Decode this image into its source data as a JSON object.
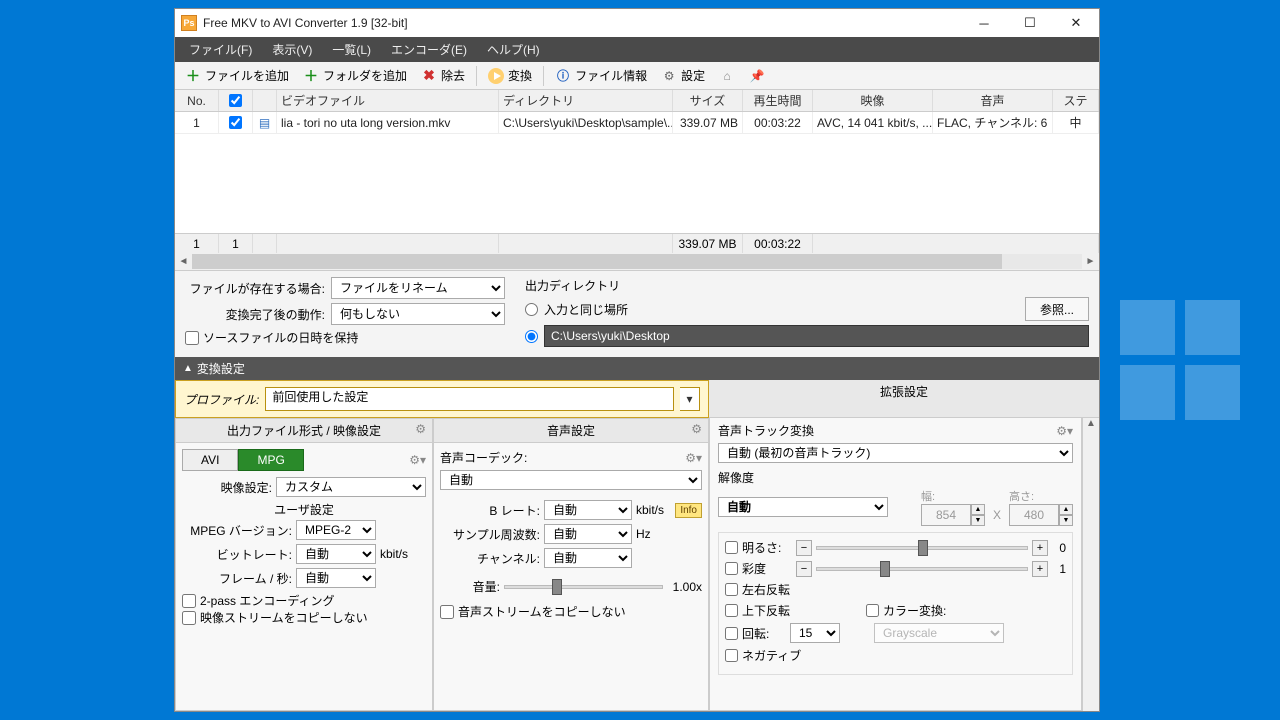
{
  "window": {
    "title": "Free MKV to AVI Converter 1.9  [32-bit]"
  },
  "menu": {
    "file": "ファイル(F)",
    "view": "表示(V)",
    "list": "一覧(L)",
    "encoder": "エンコーダ(E)",
    "help": "ヘルプ(H)"
  },
  "toolbar": {
    "add_file": "ファイルを追加",
    "add_folder": "フォルダを追加",
    "remove": "除去",
    "convert": "変換",
    "file_info": "ファイル情報",
    "settings": "設定"
  },
  "grid": {
    "headers": {
      "no": "No.",
      "video_file": "ビデオファイル",
      "directory": "ディレクトリ",
      "size": "サイズ",
      "duration": "再生時間",
      "video": "映像",
      "audio": "音声",
      "status": "ステ"
    },
    "row": {
      "no": "1",
      "file": "lia - tori no uta long version.mkv",
      "dir": "C:\\Users\\yuki\\Desktop\\sample\\...",
      "size": "339.07 MB",
      "duration": "00:03:22",
      "video": "AVC, 14 041 kbit/s, ...",
      "audio": "FLAC, チャンネル: 6",
      "status": "中"
    },
    "footer": {
      "count1": "1",
      "count2": "1",
      "size": "339.07 MB",
      "duration": "00:03:22"
    }
  },
  "opts": {
    "exists_label": "ファイルが存在する場合:",
    "exists_value": "ファイルをリネーム",
    "after_label": "変換完了後の動作:",
    "after_value": "何もしない",
    "preserve_date": "ソースファイルの日時を保持",
    "outdir_label": "出力ディレクトリ",
    "same_as_input": "入力と同じ場所",
    "custom_path": "C:\\Users\\yuki\\Desktop",
    "browse": "参照..."
  },
  "conv": {
    "section": "変換設定",
    "profile_label": "プロファイル:",
    "profile_value": "前回使用した設定",
    "video_panel": "出力ファイル形式 / 映像設定",
    "audio_panel": "音声設定",
    "ext_panel": "拡張設定",
    "tab_avi": "AVI",
    "tab_mpg": "MPG",
    "vset_label": "映像設定:",
    "vset_value": "カスタム",
    "user_set": "ユーザ設定",
    "mpeg_ver_label": "MPEG バージョン:",
    "mpeg_ver_value": "MPEG-2",
    "bitrate_label": "ビットレート:",
    "bitrate_value": "自動",
    "bitrate_unit": "kbit/s",
    "fps_label": "フレーム / 秒:",
    "fps_value": "自動",
    "twopass": "2-pass エンコーディング",
    "copy_vstream": "映像ストリームをコピーしない",
    "acodec_label": "音声コーデック:",
    "acodec_value": "自動",
    "abitrate_label": "B レート:",
    "abitrate_value": "自動",
    "abitrate_unit": "kbit/s",
    "asample_label": "サンプル周波数:",
    "asample_value": "自動",
    "asample_unit": "Hz",
    "achannel_label": "チャンネル:",
    "achannel_value": "自動",
    "avolume_label": "音量:",
    "avolume_value": "1.00x",
    "copy_astream": "音声ストリームをコピーしない",
    "info_badge": "Info",
    "atrack_label": "音声トラック変換",
    "atrack_value": "自動 (最初の音声トラック)",
    "res_label": "解像度",
    "res_value": "自動",
    "width_label": "幅:",
    "width_value": "854",
    "height_label": "高さ:",
    "height_value": "480",
    "x": "X",
    "brightness": "明るさ:",
    "brightness_val": "0",
    "saturation": "彩度",
    "saturation_val": "1",
    "flip_h": "左右反転",
    "flip_v": "上下反転",
    "rotate": "回転:",
    "rotate_value": "15",
    "negative": "ネガティブ",
    "color_conv": "カラー変換:",
    "color_conv_value": "Grayscale"
  }
}
